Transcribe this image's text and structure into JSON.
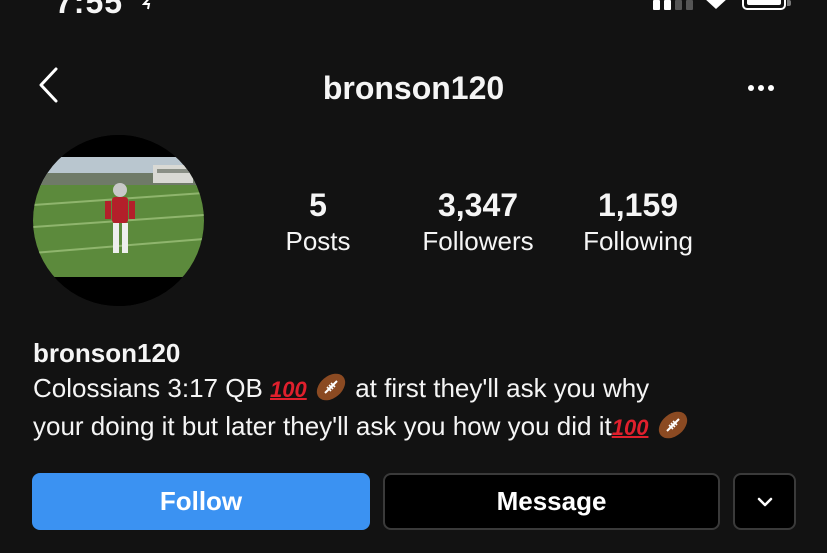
{
  "status_bar": {
    "time": "7:55"
  },
  "header": {
    "username": "bronson120"
  },
  "stats": [
    {
      "value": "5",
      "label": "Posts"
    },
    {
      "value": "3,347",
      "label": "Followers"
    },
    {
      "value": "1,159",
      "label": "Following"
    }
  ],
  "bio": {
    "name": "bronson120",
    "line1_a": "Colossians 3:17 QB",
    "line1_b": "at first they'll ask you why",
    "line2": "your doing it but later they'll ask you how you did it",
    "hundred_emoji": "100"
  },
  "actions": {
    "follow_label": "Follow",
    "message_label": "Message"
  },
  "colors": {
    "background": "#121212",
    "follow_blue": "#3b92f2",
    "hundred_red": "#e0202d"
  },
  "icons": [
    "location-arrow-icon",
    "signal-icon",
    "wifi-icon",
    "battery-icon",
    "back-chevron-icon",
    "more-options-icon",
    "football-emoji-icon",
    "chevron-down-icon"
  ]
}
